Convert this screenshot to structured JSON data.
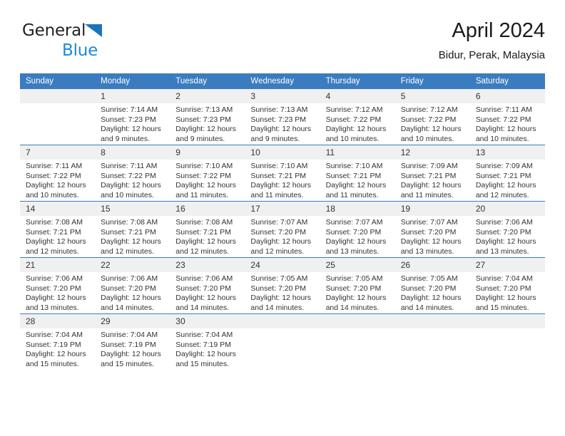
{
  "brand": {
    "name_part1": "General",
    "name_part2": "Blue",
    "triangle_color": "#1b75bb",
    "blue_color": "#1b8ad6"
  },
  "header": {
    "title": "April 2024",
    "subtitle": "Bidur, Perak, Malaysia"
  },
  "theme": {
    "header_blue": "#3b7cc0",
    "daynum_gray": "#f0f0f0",
    "text": "#333333"
  },
  "weekdays": [
    "Sunday",
    "Monday",
    "Tuesday",
    "Wednesday",
    "Thursday",
    "Friday",
    "Saturday"
  ],
  "weeks": [
    [
      {
        "day": "",
        "sunrise": "",
        "sunset": "",
        "daylight1": "",
        "daylight2": ""
      },
      {
        "day": "1",
        "sunrise": "Sunrise: 7:14 AM",
        "sunset": "Sunset: 7:23 PM",
        "daylight1": "Daylight: 12 hours",
        "daylight2": "and 9 minutes."
      },
      {
        "day": "2",
        "sunrise": "Sunrise: 7:13 AM",
        "sunset": "Sunset: 7:23 PM",
        "daylight1": "Daylight: 12 hours",
        "daylight2": "and 9 minutes."
      },
      {
        "day": "3",
        "sunrise": "Sunrise: 7:13 AM",
        "sunset": "Sunset: 7:23 PM",
        "daylight1": "Daylight: 12 hours",
        "daylight2": "and 9 minutes."
      },
      {
        "day": "4",
        "sunrise": "Sunrise: 7:12 AM",
        "sunset": "Sunset: 7:22 PM",
        "daylight1": "Daylight: 12 hours",
        "daylight2": "and 10 minutes."
      },
      {
        "day": "5",
        "sunrise": "Sunrise: 7:12 AM",
        "sunset": "Sunset: 7:22 PM",
        "daylight1": "Daylight: 12 hours",
        "daylight2": "and 10 minutes."
      },
      {
        "day": "6",
        "sunrise": "Sunrise: 7:11 AM",
        "sunset": "Sunset: 7:22 PM",
        "daylight1": "Daylight: 12 hours",
        "daylight2": "and 10 minutes."
      }
    ],
    [
      {
        "day": "7",
        "sunrise": "Sunrise: 7:11 AM",
        "sunset": "Sunset: 7:22 PM",
        "daylight1": "Daylight: 12 hours",
        "daylight2": "and 10 minutes."
      },
      {
        "day": "8",
        "sunrise": "Sunrise: 7:11 AM",
        "sunset": "Sunset: 7:22 PM",
        "daylight1": "Daylight: 12 hours",
        "daylight2": "and 10 minutes."
      },
      {
        "day": "9",
        "sunrise": "Sunrise: 7:10 AM",
        "sunset": "Sunset: 7:22 PM",
        "daylight1": "Daylight: 12 hours",
        "daylight2": "and 11 minutes."
      },
      {
        "day": "10",
        "sunrise": "Sunrise: 7:10 AM",
        "sunset": "Sunset: 7:21 PM",
        "daylight1": "Daylight: 12 hours",
        "daylight2": "and 11 minutes."
      },
      {
        "day": "11",
        "sunrise": "Sunrise: 7:10 AM",
        "sunset": "Sunset: 7:21 PM",
        "daylight1": "Daylight: 12 hours",
        "daylight2": "and 11 minutes."
      },
      {
        "day": "12",
        "sunrise": "Sunrise: 7:09 AM",
        "sunset": "Sunset: 7:21 PM",
        "daylight1": "Daylight: 12 hours",
        "daylight2": "and 11 minutes."
      },
      {
        "day": "13",
        "sunrise": "Sunrise: 7:09 AM",
        "sunset": "Sunset: 7:21 PM",
        "daylight1": "Daylight: 12 hours",
        "daylight2": "and 12 minutes."
      }
    ],
    [
      {
        "day": "14",
        "sunrise": "Sunrise: 7:08 AM",
        "sunset": "Sunset: 7:21 PM",
        "daylight1": "Daylight: 12 hours",
        "daylight2": "and 12 minutes."
      },
      {
        "day": "15",
        "sunrise": "Sunrise: 7:08 AM",
        "sunset": "Sunset: 7:21 PM",
        "daylight1": "Daylight: 12 hours",
        "daylight2": "and 12 minutes."
      },
      {
        "day": "16",
        "sunrise": "Sunrise: 7:08 AM",
        "sunset": "Sunset: 7:21 PM",
        "daylight1": "Daylight: 12 hours",
        "daylight2": "and 12 minutes."
      },
      {
        "day": "17",
        "sunrise": "Sunrise: 7:07 AM",
        "sunset": "Sunset: 7:20 PM",
        "daylight1": "Daylight: 12 hours",
        "daylight2": "and 12 minutes."
      },
      {
        "day": "18",
        "sunrise": "Sunrise: 7:07 AM",
        "sunset": "Sunset: 7:20 PM",
        "daylight1": "Daylight: 12 hours",
        "daylight2": "and 13 minutes."
      },
      {
        "day": "19",
        "sunrise": "Sunrise: 7:07 AM",
        "sunset": "Sunset: 7:20 PM",
        "daylight1": "Daylight: 12 hours",
        "daylight2": "and 13 minutes."
      },
      {
        "day": "20",
        "sunrise": "Sunrise: 7:06 AM",
        "sunset": "Sunset: 7:20 PM",
        "daylight1": "Daylight: 12 hours",
        "daylight2": "and 13 minutes."
      }
    ],
    [
      {
        "day": "21",
        "sunrise": "Sunrise: 7:06 AM",
        "sunset": "Sunset: 7:20 PM",
        "daylight1": "Daylight: 12 hours",
        "daylight2": "and 13 minutes."
      },
      {
        "day": "22",
        "sunrise": "Sunrise: 7:06 AM",
        "sunset": "Sunset: 7:20 PM",
        "daylight1": "Daylight: 12 hours",
        "daylight2": "and 14 minutes."
      },
      {
        "day": "23",
        "sunrise": "Sunrise: 7:06 AM",
        "sunset": "Sunset: 7:20 PM",
        "daylight1": "Daylight: 12 hours",
        "daylight2": "and 14 minutes."
      },
      {
        "day": "24",
        "sunrise": "Sunrise: 7:05 AM",
        "sunset": "Sunset: 7:20 PM",
        "daylight1": "Daylight: 12 hours",
        "daylight2": "and 14 minutes."
      },
      {
        "day": "25",
        "sunrise": "Sunrise: 7:05 AM",
        "sunset": "Sunset: 7:20 PM",
        "daylight1": "Daylight: 12 hours",
        "daylight2": "and 14 minutes."
      },
      {
        "day": "26",
        "sunrise": "Sunrise: 7:05 AM",
        "sunset": "Sunset: 7:20 PM",
        "daylight1": "Daylight: 12 hours",
        "daylight2": "and 14 minutes."
      },
      {
        "day": "27",
        "sunrise": "Sunrise: 7:04 AM",
        "sunset": "Sunset: 7:20 PM",
        "daylight1": "Daylight: 12 hours",
        "daylight2": "and 15 minutes."
      }
    ],
    [
      {
        "day": "28",
        "sunrise": "Sunrise: 7:04 AM",
        "sunset": "Sunset: 7:19 PM",
        "daylight1": "Daylight: 12 hours",
        "daylight2": "and 15 minutes."
      },
      {
        "day": "29",
        "sunrise": "Sunrise: 7:04 AM",
        "sunset": "Sunset: 7:19 PM",
        "daylight1": "Daylight: 12 hours",
        "daylight2": "and 15 minutes."
      },
      {
        "day": "30",
        "sunrise": "Sunrise: 7:04 AM",
        "sunset": "Sunset: 7:19 PM",
        "daylight1": "Daylight: 12 hours",
        "daylight2": "and 15 minutes."
      },
      {
        "day": "",
        "sunrise": "",
        "sunset": "",
        "daylight1": "",
        "daylight2": ""
      },
      {
        "day": "",
        "sunrise": "",
        "sunset": "",
        "daylight1": "",
        "daylight2": ""
      },
      {
        "day": "",
        "sunrise": "",
        "sunset": "",
        "daylight1": "",
        "daylight2": ""
      },
      {
        "day": "",
        "sunrise": "",
        "sunset": "",
        "daylight1": "",
        "daylight2": ""
      }
    ]
  ]
}
